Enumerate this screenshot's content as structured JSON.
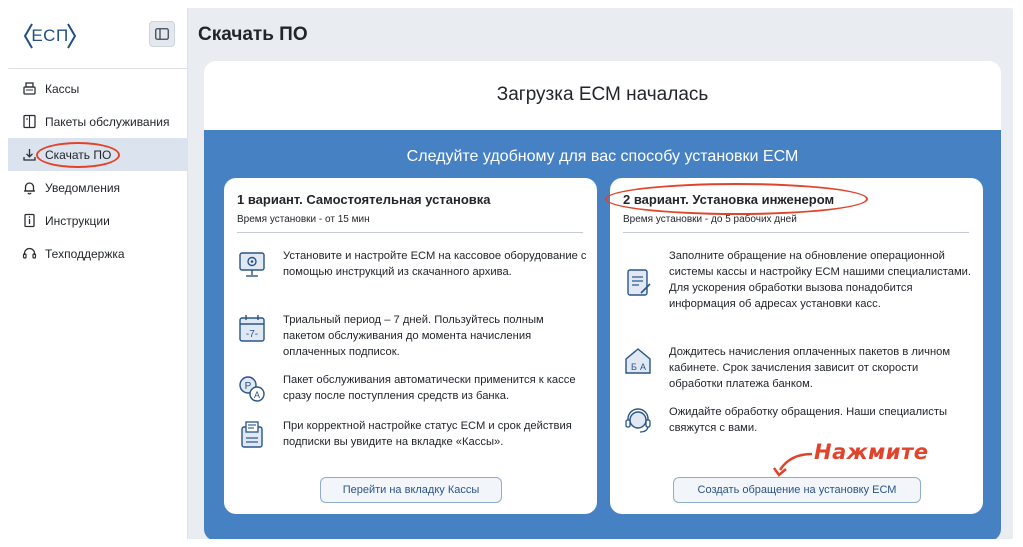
{
  "app": {
    "logo_text": "ЕСП",
    "brand_color": "#1f4f86"
  },
  "sidebar": {
    "items": [
      {
        "label": "Кассы",
        "icon": "cash-register-icon"
      },
      {
        "label": "Пакеты обслуживания",
        "icon": "package-icon"
      },
      {
        "label": "Скачать ПО",
        "icon": "download-icon",
        "active": true
      },
      {
        "label": "Уведомления",
        "icon": "bell-icon"
      },
      {
        "label": "Инструкции",
        "icon": "instructions-icon"
      },
      {
        "label": "Техподдержка",
        "icon": "headset-icon"
      }
    ]
  },
  "header": {
    "title": "Скачать ПО"
  },
  "main": {
    "heading": "Загрузка ЕСМ началась",
    "panel_heading": "Следуйте удобному для вас способу установки ЕСМ",
    "panel_color": "#4681c3",
    "variants": [
      {
        "title": "1 вариант. Самостоятельная установка",
        "subtitle": "Время установки - от 15 мин",
        "steps": [
          {
            "icon": "settings-monitor-icon",
            "text": "Установите и настройте ЕСМ на кассовое оборудование с помощью инструкций из скачанного архива."
          },
          {
            "icon": "calendar-7-icon",
            "text": "Триальный период – 7 дней. Пользуйтесь полным пакетом обслуживания до момента начисления оплаченных подписок."
          },
          {
            "icon": "package-auto-icon",
            "text": "Пакет обслуживания автоматически применится к кассе сразу после поступления средств из банка."
          },
          {
            "icon": "receipt-status-icon",
            "text": "При корректной настройке статус ЕСМ и срок действия подписки вы увидите на вкладке «Кассы»."
          }
        ],
        "button_label": "Перейти на вкладку Кассы"
      },
      {
        "title": "2 вариант. Установка инженером",
        "subtitle": "Время установки - до 5 рабочих дней",
        "steps": [
          {
            "icon": "request-form-icon",
            "text": "Заполните обращение на обновление операционной системы кассы и настройку ЕСМ нашими специалистами. Для ускорения обработки вызова понадобится информация об адресах установки касс."
          },
          {
            "icon": "packages-cabinet-icon",
            "text": "Дождитесь начисления оплаченных пакетов в личном кабинете. Срок зачисления зависит от скорости обработки платежа банком."
          },
          {
            "icon": "support-headset-icon",
            "text": "Ожидайте обработку обращения. Наши специалисты свяжутся с вами."
          }
        ],
        "button_label": "Создать обращение на установку ЕСМ"
      }
    ]
  },
  "annotation": {
    "text": "Нажмите",
    "color": "#e2432a"
  }
}
